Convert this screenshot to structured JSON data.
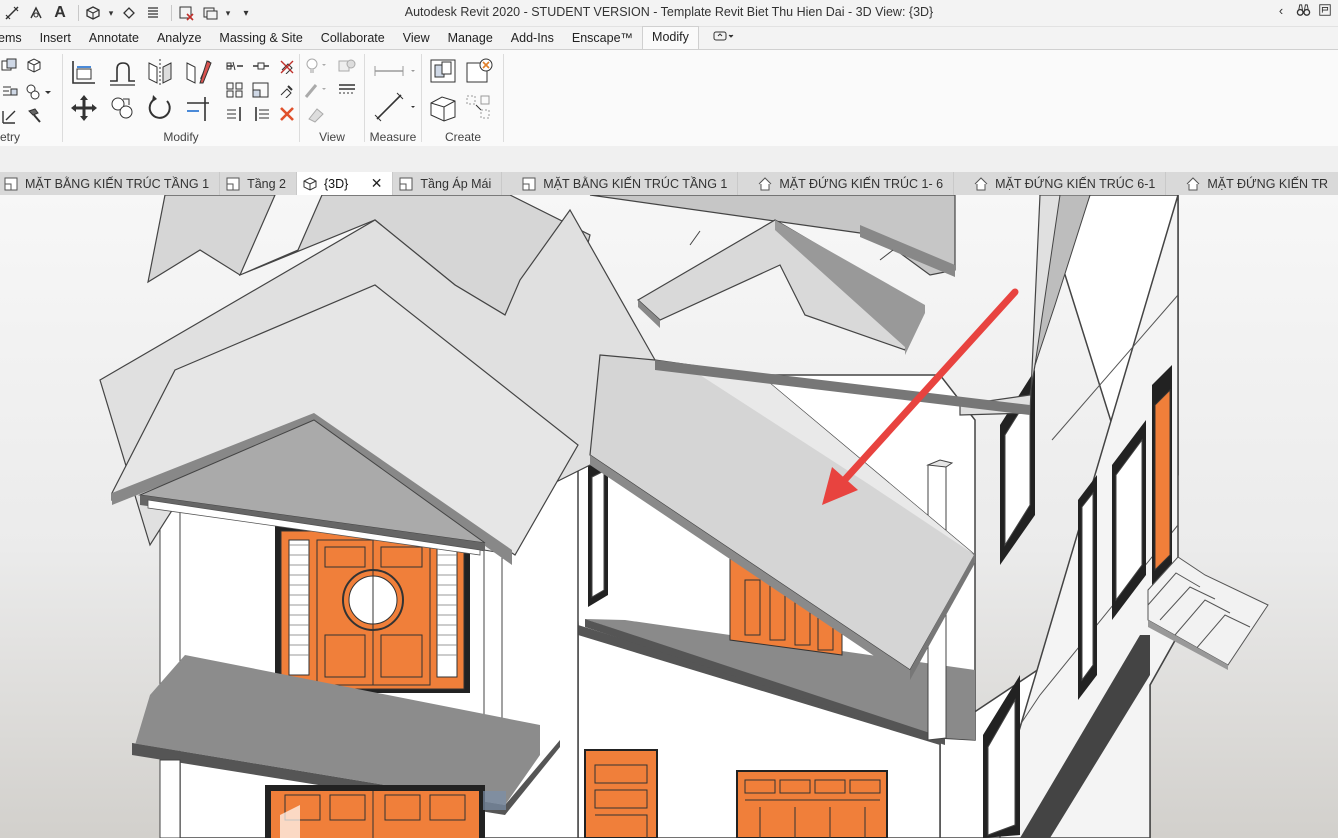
{
  "window": {
    "title": "Autodesk Revit 2020 - STUDENT VERSION - Template Revit Biet Thu Hien Dai - 3D View: {3D}"
  },
  "quick_access": {
    "text_tool_glyph": "A"
  },
  "ribbon_tabs": [
    {
      "label": "ems",
      "active": false
    },
    {
      "label": "Insert",
      "active": false
    },
    {
      "label": "Annotate",
      "active": false
    },
    {
      "label": "Analyze",
      "active": false
    },
    {
      "label": "Massing & Site",
      "active": false
    },
    {
      "label": "Collaborate",
      "active": false
    },
    {
      "label": "View",
      "active": false
    },
    {
      "label": "Manage",
      "active": false
    },
    {
      "label": "Add-Ins",
      "active": false
    },
    {
      "label": "Enscape™",
      "active": false
    },
    {
      "label": "Modify",
      "active": true
    }
  ],
  "ribbon_panels": {
    "geometry": "etry",
    "modify": "Modify",
    "view": "View",
    "measure": "Measure",
    "create": "Create"
  },
  "view_tabs": [
    {
      "label": "MẶT BẰNG KIẾN TRÚC TẦNG 1",
      "icon": "floor-plan-icon",
      "active": false
    },
    {
      "label": "Tầng 2",
      "icon": "floor-plan-icon",
      "active": false
    },
    {
      "label": "{3D}",
      "icon": "3d-view-icon",
      "active": true
    },
    {
      "label": "Tầng Áp Mái",
      "icon": "floor-plan-icon",
      "active": false
    },
    {
      "label": "MẶT BẰNG KIẾN TRÚC TẦNG 1",
      "icon": "floor-plan-icon",
      "active": false
    },
    {
      "label": "MẶT ĐỨNG KIẾN TRÚC 1- 6",
      "icon": "elevation-icon",
      "active": false
    },
    {
      "label": "MẶT ĐỨNG KIẾN TRÚC 6-1",
      "icon": "elevation-icon",
      "active": false
    },
    {
      "label": "MẶT ĐỨNG KIẾN TR",
      "icon": "elevation-icon",
      "active": false
    }
  ],
  "colors": {
    "roof": "#d4d4d4",
    "roof_dark": "#9a9a9a",
    "wall": "#ffffff",
    "door": "#f07f3a",
    "arrow": "#e8433f",
    "active_tab_bg": "#ffffff",
    "viewtab_bar": "#d9d9d9"
  }
}
